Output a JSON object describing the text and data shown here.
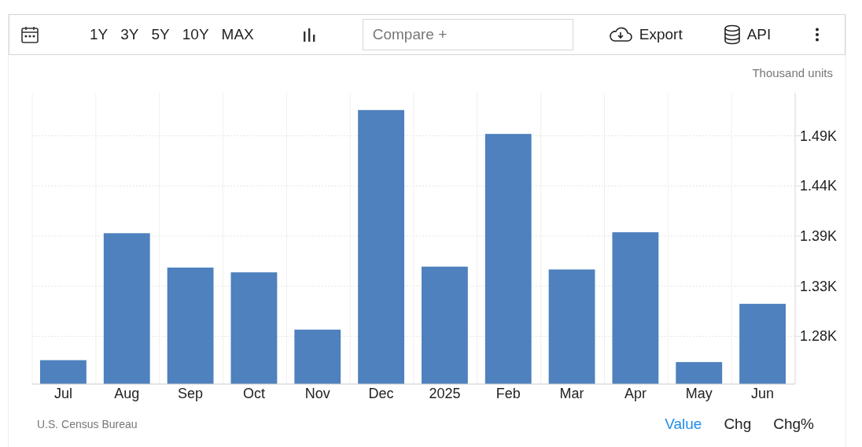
{
  "toolbar": {
    "ranges": [
      {
        "label": "1Y",
        "selected": false
      },
      {
        "label": "3Y",
        "selected": false
      },
      {
        "label": "5Y",
        "selected": false
      },
      {
        "label": "10Y",
        "selected": false
      },
      {
        "label": "MAX",
        "selected": false
      }
    ],
    "compare": {
      "placeholder": "Compare +"
    },
    "export": "Export",
    "api": "API"
  },
  "units": "Thousand units",
  "chart_data": {
    "type": "bar",
    "categories": [
      "Jul",
      "Aug",
      "Sep",
      "Oct",
      "Nov",
      "Dec",
      "2025",
      "Feb",
      "Mar",
      "Apr",
      "May",
      "Jun"
    ],
    "grid": true,
    "series": [
      {
        "color": "#4e81bd",
        "values": [
          1255,
          1388,
          1352,
          1347,
          1287,
          1517,
          1353,
          1492,
          1350,
          1389,
          1253,
          1314
        ]
      }
    ],
    "ylim": [
      1230,
      1535
    ],
    "yticks": [
      {
        "value": 1280,
        "label": "1.28K"
      },
      {
        "value": 1332.5,
        "label": "1.33K"
      },
      {
        "value": 1385,
        "label": "1.39K"
      },
      {
        "value": 1437.5,
        "label": "1.44K"
      },
      {
        "value": 1490,
        "label": "1.49K"
      }
    ]
  },
  "source": "U.S. Census Bureau",
  "views": [
    {
      "label": "Value",
      "selected": true
    },
    {
      "label": "Chg",
      "selected": false
    },
    {
      "label": "Chg%",
      "selected": false
    }
  ]
}
